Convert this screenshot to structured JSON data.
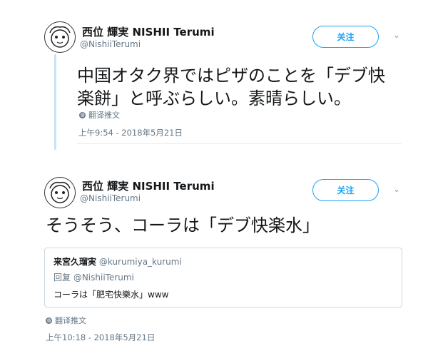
{
  "tweet1": {
    "name": "西位 輝実 NISHII Terumi",
    "handle": "@NishiiTerumi",
    "follow_label": "关注",
    "text_line1": "中国オタク界ではピザのことを「デブ快",
    "text_line2": "楽餅」と呼ぶらしい。素晴らしい。",
    "translate_label": "翻译推文",
    "timestamp": "上午9:54 - 2018年5月21日"
  },
  "tweet2": {
    "name": "西位 輝実 NISHII Terumi",
    "handle": "@NishiiTerumi",
    "follow_label": "关注",
    "text": "そうそう、コーラは「デブ快楽水」",
    "quote": {
      "name": "来宮久瑠実",
      "handle": "@kurumiya_kurumi",
      "reply_to": "回复 @NishiiTerumi",
      "text": "コーラは「肥宅快樂水」www"
    },
    "translate_label": "翻译推文",
    "timestamp": "上午10:18 - 2018年5月21日"
  },
  "icons": {
    "avatar": "avatar-illustration",
    "caret": "chevron-down-icon",
    "globe": "globe-icon"
  },
  "colors": {
    "accent": "#1da1f2",
    "thread": "#c4e4f7",
    "muted": "#657786"
  }
}
